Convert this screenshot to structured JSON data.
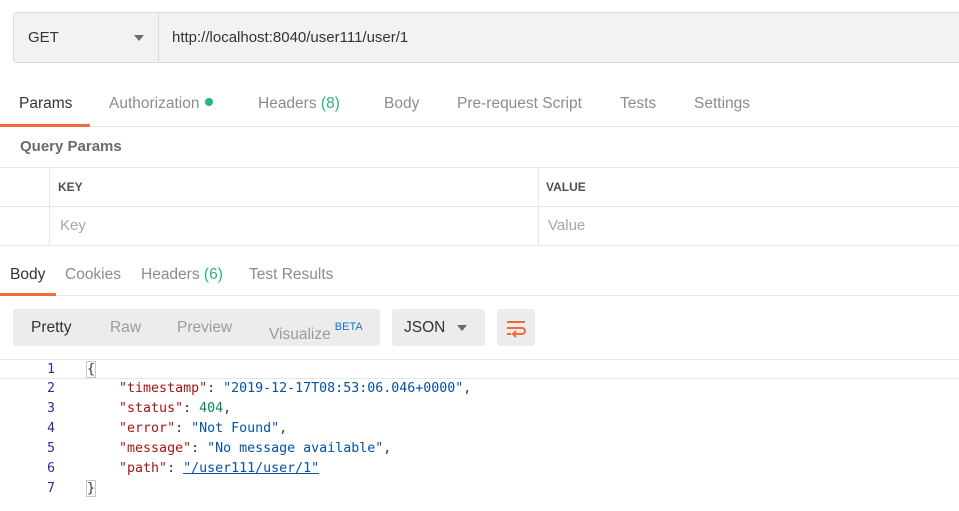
{
  "request": {
    "method": "GET",
    "url": "http://localhost:8040/user111/user/1"
  },
  "request_tabs": [
    {
      "label": "Params",
      "count": ""
    },
    {
      "label": "Authorization",
      "count": ""
    },
    {
      "label": "Headers",
      "count": "(8)"
    },
    {
      "label": "Body",
      "count": ""
    },
    {
      "label": "Pre-request Script",
      "count": ""
    },
    {
      "label": "Tests",
      "count": ""
    },
    {
      "label": "Settings",
      "count": ""
    }
  ],
  "query_params": {
    "title": "Query Params",
    "headers": [
      "KEY",
      "VALUE"
    ],
    "placeholders": [
      "Key",
      "Value"
    ]
  },
  "response_tabs": [
    {
      "label": "Body",
      "count": ""
    },
    {
      "label": "Cookies",
      "count": ""
    },
    {
      "label": "Headers",
      "count": "(6)"
    },
    {
      "label": "Test Results",
      "count": ""
    }
  ],
  "view_modes": [
    "Pretty",
    "Raw",
    "Preview",
    "Visualize"
  ],
  "beta_label": "BETA",
  "format": "JSON",
  "response_body": {
    "line_numbers": [
      "1",
      "2",
      "3",
      "4",
      "5",
      "6",
      "7"
    ],
    "open_brace": "{",
    "close_brace": "}",
    "fields": [
      {
        "key": "\"timestamp\"",
        "value": "\"2019-12-17T08:53:06.046+0000\"",
        "comma": ","
      },
      {
        "key": "\"status\"",
        "value": "404",
        "comma": ","
      },
      {
        "key": "\"error\"",
        "value": "\"Not Found\"",
        "comma": ","
      },
      {
        "key": "\"message\"",
        "value": "\"No message available\"",
        "comma": ","
      },
      {
        "key": "\"path\"",
        "value": "\"/user111/user/1\"",
        "comma": ""
      }
    ]
  },
  "colors": {
    "accent": "#f26b3a",
    "count_green": "#26b47f",
    "json_key": "#a31515",
    "json_string": "#0451a5",
    "json_number": "#098658"
  },
  "icons": [
    "chevron-down-icon",
    "green-dot-icon",
    "wrap-lines-icon"
  ]
}
